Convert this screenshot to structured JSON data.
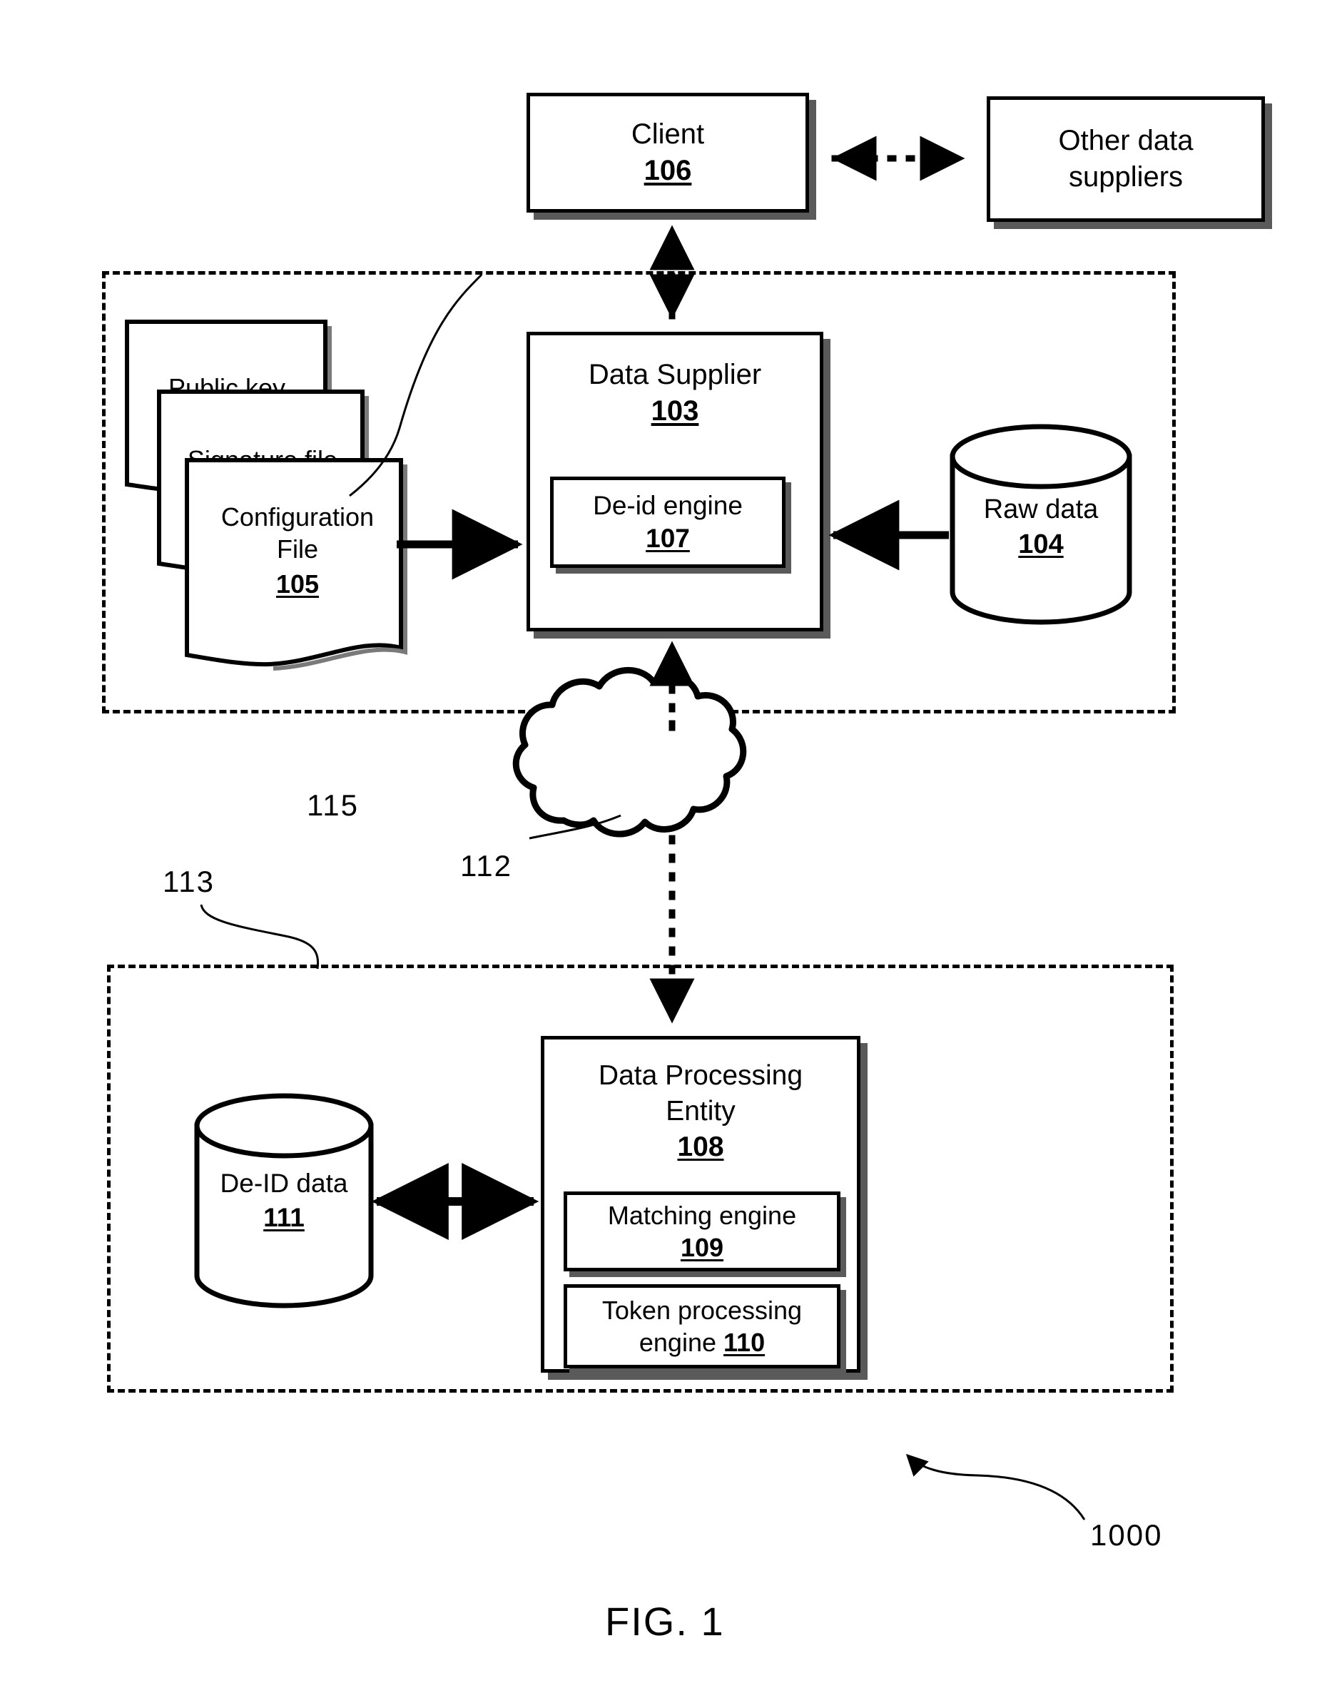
{
  "figure": {
    "caption": "FIG. 1",
    "overall_ref": "1000"
  },
  "nodes": {
    "client": {
      "label": "Client",
      "number": "106"
    },
    "other_suppliers": {
      "label_line1": "Other data",
      "label_line2": "suppliers"
    },
    "data_supplier": {
      "label": "Data Supplier",
      "number": "103"
    },
    "deid_engine": {
      "label": "De-id engine",
      "number": "107"
    },
    "raw_data": {
      "label": "Raw data",
      "number": "104"
    },
    "data_processing_entity": {
      "label_line1": "Data Processing",
      "label_line2": "Entity",
      "number": "108"
    },
    "matching_engine": {
      "label": "Matching engine",
      "number": "109"
    },
    "token_processing_engine": {
      "label_line1": "Token processing",
      "label_line2": "engine",
      "number": "110"
    },
    "deid_data": {
      "label": "De-ID data",
      "number": "111"
    }
  },
  "documents": [
    {
      "name": "public-key",
      "label": "Public key",
      "number": ""
    },
    {
      "name": "signature-file",
      "label": "Signature file",
      "number": ""
    },
    {
      "name": "configuration-file",
      "label_line1": "Configuration",
      "label_line2": "File",
      "number": "105"
    }
  ],
  "regions": {
    "supplier_domain_ref": "115",
    "processing_domain_ref": "113"
  },
  "network": {
    "cloud_ref": "112"
  },
  "colors": {
    "line": "#000000",
    "fill": "#ffffff",
    "shadow": "#5a5a5a"
  }
}
